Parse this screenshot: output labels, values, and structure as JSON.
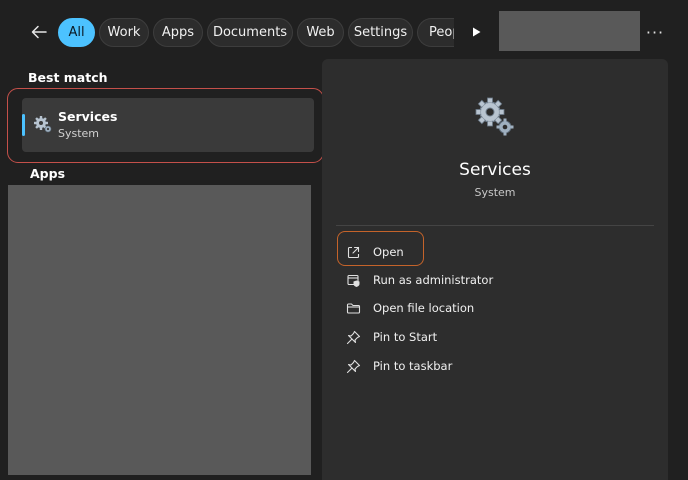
{
  "filters": {
    "tabs": [
      {
        "label": "All",
        "active": true
      },
      {
        "label": "Work",
        "active": false
      },
      {
        "label": "Apps",
        "active": false
      },
      {
        "label": "Documents",
        "active": false
      },
      {
        "label": "Web",
        "active": false
      },
      {
        "label": "Settings",
        "active": false
      },
      {
        "label": "Peop",
        "active": false
      }
    ],
    "more_label": "···"
  },
  "best_match": {
    "section_title": "Best match",
    "item": {
      "title": "Services",
      "subtitle": "System",
      "icon": "gears-icon"
    }
  },
  "apps": {
    "section_title": "Apps"
  },
  "details": {
    "title": "Services",
    "subtitle": "System",
    "icon": "gears-icon",
    "actions": [
      {
        "label": "Open",
        "icon": "open-external-icon"
      },
      {
        "label": "Run as administrator",
        "icon": "shield-admin-icon"
      },
      {
        "label": "Open file location",
        "icon": "folder-icon"
      },
      {
        "label": "Pin to Start",
        "icon": "pin-icon"
      },
      {
        "label": "Pin to taskbar",
        "icon": "pin-icon"
      }
    ]
  },
  "colors": {
    "accent": "#4cc2ff",
    "background": "#202020",
    "panel": "#2d2d2d",
    "highlight_red": "#c4504a",
    "highlight_orange": "#c4632a"
  }
}
